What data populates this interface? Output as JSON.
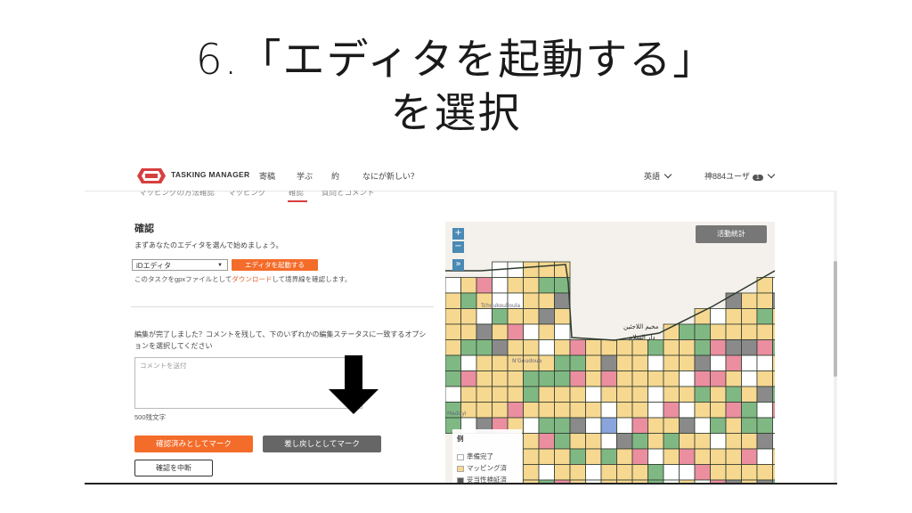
{
  "slide": {
    "title_line1": "6.「エディタを起動する」",
    "title_line2": "を選択"
  },
  "nav": {
    "brand": "TASKING MANAGER",
    "links": [
      "寄稿",
      "学ぶ",
      "約",
      "なにが新しい？"
    ],
    "language": "英語",
    "user": "神884ユーザ",
    "notification_count": "1"
  },
  "subtabs": [
    "マッピングの方法確認",
    "マッピング",
    "確認",
    "質問とコメント"
  ],
  "panel": {
    "heading": "確認",
    "instruction": "まずあなたのエディタを選んで始めましょう。",
    "editor_selected": "iDエディタ",
    "start_editor": "エディタを起動する",
    "gpx_prefix": "このタスクをgpxファイルとして",
    "gpx_link": "ダウンロード",
    "gpx_suffix": "して境界線を確認します。",
    "done_question": "編集が完了しました？コメントを残して、下のいずれかの編集ステータスに一致するオプションを選択してください",
    "comment_placeholder": "コメントを送付",
    "char_limit": "500残文字",
    "mark_validated": "確認済みとしてマーク",
    "mark_invalid": "差し戻しとしてマーク",
    "stop_validation": "確認を中断"
  },
  "map": {
    "zoom_in": "+",
    "zoom_out": "−",
    "expand": "»",
    "stats_button": "活動統計",
    "place_labels": [
      "N'Goudoua",
      "Madayi",
      "Tchoukoulloula"
    ],
    "arabic_labels": [
      "مخيم اللاجئين",
      "دار السلام"
    ],
    "legend_title": "例",
    "legend_items": [
      "準備完了",
      "マッピング済",
      "妥当性検証済"
    ],
    "colors": {
      "ready": "#ffffff",
      "mapped": "#f7d891",
      "validated": "#80b884",
      "invalid": "#eb8ea0",
      "locked": "#8a8a8a",
      "selected": "#8aa4dc",
      "grid": "#2e3a2e"
    }
  },
  "colors": {
    "accent": "#f46c2a",
    "revert": "#666666",
    "map_button": "#4a8ab5"
  }
}
